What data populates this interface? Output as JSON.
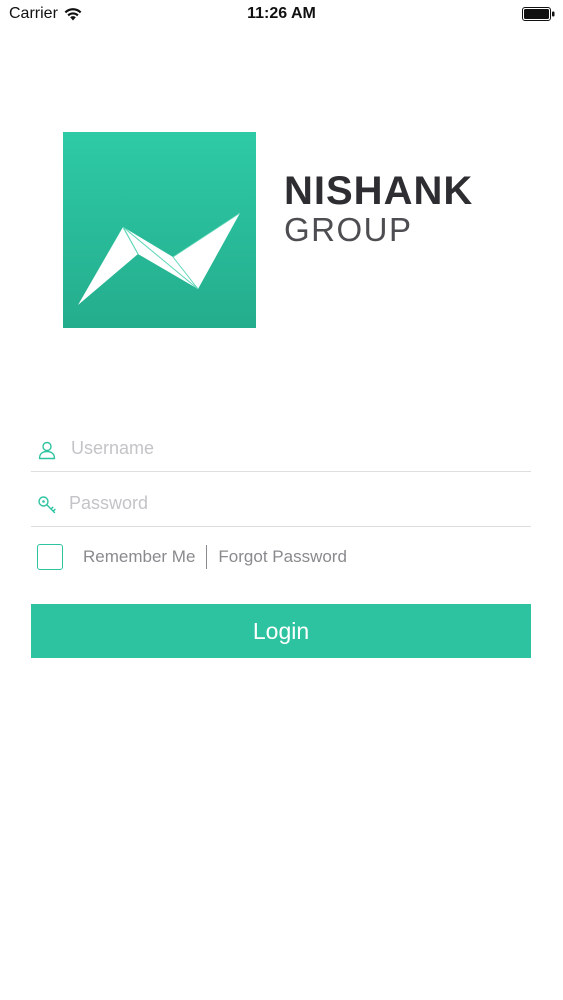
{
  "status_bar": {
    "carrier": "Carrier",
    "time": "11:26 AM",
    "icons": [
      "wifi-icon",
      "battery-icon"
    ]
  },
  "branding": {
    "logo_icon": "folded-paper-logo-icon",
    "name": "NISHANK",
    "subtitle": "GROUP",
    "logo_color": "#2ecaa6",
    "name_color": "#2e2e32"
  },
  "login_form": {
    "username": {
      "icon": "user-icon",
      "value": "",
      "placeholder": "Username"
    },
    "password": {
      "icon": "key-icon",
      "value": "",
      "placeholder": "Password"
    },
    "remember_me": {
      "label": "Remember Me",
      "checked": false
    },
    "forgot_password_label": "Forgot Password",
    "login_label": "Login"
  },
  "colors": {
    "accent": "#2ec3a0",
    "muted_text": "#8a8a8e",
    "placeholder": "#c4c4c8",
    "divider": "#dedede"
  }
}
